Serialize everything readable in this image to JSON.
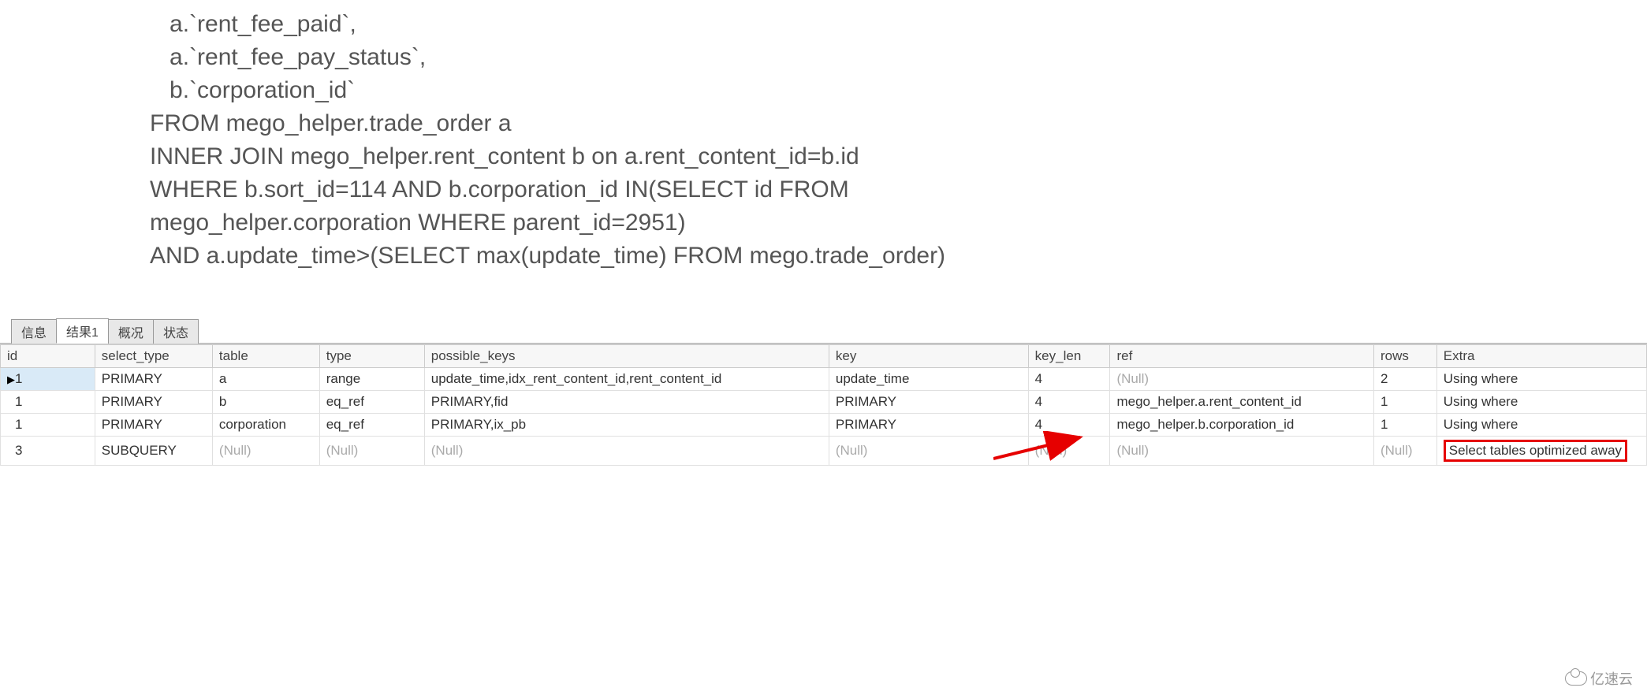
{
  "sql": {
    "lines": [
      "   a.`rent_fee_paid`,",
      "   a.`rent_fee_pay_status`,",
      "   b.`corporation_id`",
      "FROM mego_helper.trade_order a",
      "INNER JOIN mego_helper.rent_content b on a.rent_content_id=b.id",
      "WHERE b.sort_id=114 AND b.corporation_id IN(SELECT id FROM",
      "mego_helper.corporation WHERE parent_id=2951)",
      "AND a.update_time>(SELECT max(update_time) FROM mego.trade_order)"
    ]
  },
  "tabs": [
    {
      "label": "信息",
      "active": false
    },
    {
      "label": "结果1",
      "active": true
    },
    {
      "label": "概况",
      "active": false
    },
    {
      "label": "状态",
      "active": false
    }
  ],
  "grid": {
    "columns": [
      "id",
      "select_type",
      "table",
      "type",
      "possible_keys",
      "key",
      "key_len",
      "ref",
      "rows",
      "Extra"
    ],
    "rows": [
      {
        "marker": "▶",
        "selected_cell_index": 0,
        "highlight_extra": false,
        "cells": [
          "1",
          "PRIMARY",
          "a",
          "range",
          "update_time,idx_rent_content_id,rent_content_id",
          "update_time",
          "4",
          "(Null)",
          "2",
          "Using where"
        ]
      },
      {
        "marker": "",
        "selected_cell_index": -1,
        "highlight_extra": false,
        "cells": [
          "1",
          "PRIMARY",
          "b",
          "eq_ref",
          "PRIMARY,fid",
          "PRIMARY",
          "4",
          "mego_helper.a.rent_content_id",
          "1",
          "Using where"
        ]
      },
      {
        "marker": "",
        "selected_cell_index": -1,
        "highlight_extra": false,
        "cells": [
          "1",
          "PRIMARY",
          "corporation",
          "eq_ref",
          "PRIMARY,ix_pb",
          "PRIMARY",
          "4",
          "mego_helper.b.corporation_id",
          "1",
          "Using where"
        ]
      },
      {
        "marker": "",
        "selected_cell_index": -1,
        "highlight_extra": true,
        "cells": [
          "3",
          "SUBQUERY",
          "(Null)",
          "(Null)",
          "(Null)",
          "(Null)",
          "(Null)",
          "(Null)",
          "(Null)",
          "Select tables optimized away"
        ]
      }
    ]
  },
  "footer": {
    "brand": "亿速云"
  }
}
